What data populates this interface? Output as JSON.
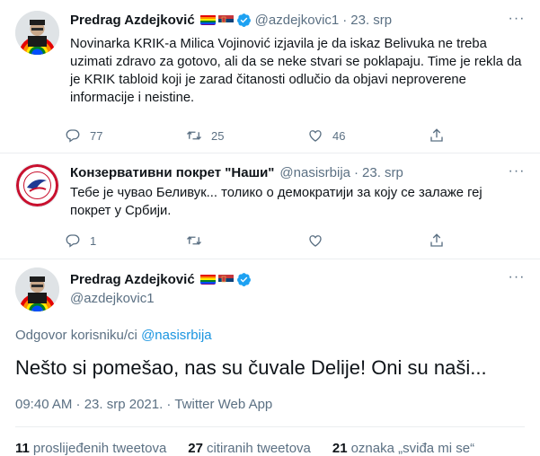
{
  "tweets": [
    {
      "name": "Predrag Azdejković",
      "handle": "@azdejkovic1",
      "date": "23. srp",
      "text": "Novinarka KRIK-a Milica Vojinović izjavila je da iskaz Belivuka ne treba uzimati zdravo za gotovo, ali da se neke stvari se poklapaju. Time je rekla da je KRIK tabloid koji je zarad čitanosti odlučio da objavi neproverene informacije i neistine.",
      "replies": "77",
      "retweets": "25",
      "likes": "46"
    },
    {
      "name": "Конзервативни покрет \"Наши\"",
      "handle": "@nasisrbija",
      "date": "23. srp",
      "text": "Тебе је чувао Беливук... толико о демократији за коју се залаже  геј покрет у Србији.",
      "replies": "1",
      "retweets": "",
      "likes": "",
      "avatar_text": "ДЕЛИЈЕ БЕОГРАДСКЕ"
    }
  ],
  "main_tweet": {
    "name": "Predrag Azdejković",
    "handle": "@azdejkovic1",
    "reply_prefix": "Odgovor korisniku/ci",
    "reply_to": "@nasisrbija",
    "text": "Nešto si pomešao, nas su čuvale Delije! Oni su naši...",
    "meta": "09:40 AM · 23. srp 2021. · Twitter Web App",
    "stats": [
      {
        "n": "11",
        "label": "proslijeđenih tweetova"
      },
      {
        "n": "27",
        "label": "citiranih tweetova"
      },
      {
        "n": "21",
        "label": "oznaka „sviđa mi se“"
      }
    ]
  },
  "colors": {
    "text": "#0f1419",
    "secondary": "#5b7083",
    "link": "#1b95e0",
    "verified": "#1da1f2"
  },
  "icons": [
    "reply-icon",
    "retweet-icon",
    "like-icon",
    "share-icon",
    "more-icon",
    "verified-icon",
    "rainbow-flag-icon",
    "serbian-flag-icon"
  ]
}
